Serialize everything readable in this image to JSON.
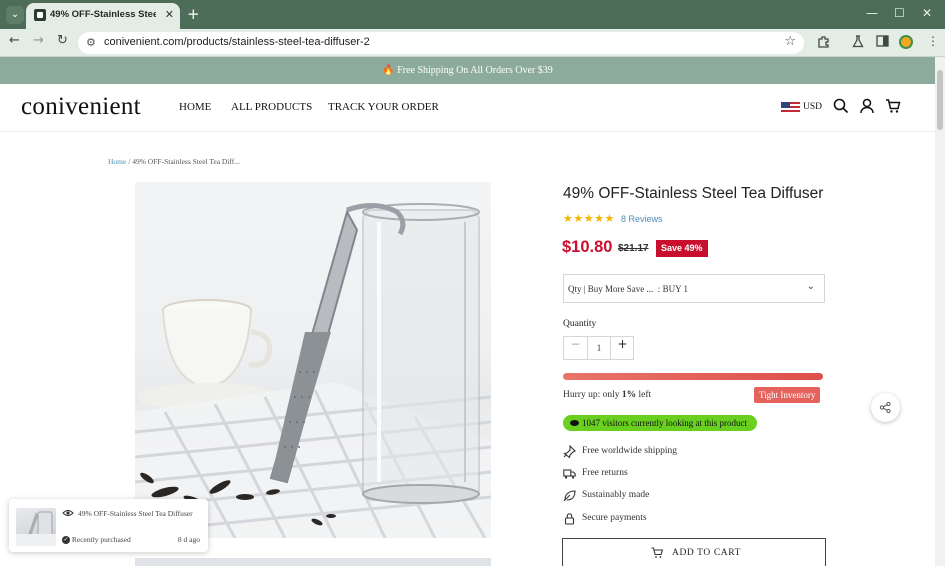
{
  "browser": {
    "tab_title": "49% OFF-Stainless Steel Tea Diffuser",
    "tab_close": "✕",
    "new_tab": "+",
    "url": "conivenient.com/products/stainless-steel-tea-diffuser-2",
    "window_controls": {
      "minimize": "—",
      "maximize": "☐",
      "close": "✕"
    }
  },
  "promo": {
    "text": "🔥 Free Shipping On All Orders Over $39"
  },
  "header": {
    "logo": "conivenient",
    "nav": [
      "HOME",
      "ALL PRODUCTS",
      "TRACK YOUR ORDER"
    ],
    "currency": "USD"
  },
  "breadcrumb": {
    "home": "Home",
    "separator": "/",
    "current": "49% OFF-Stainless Steel Tea Diff..."
  },
  "product": {
    "title": "49% OFF-Stainless Steel Tea Diffuser",
    "rating": 5,
    "stars": "★★★★★",
    "reviews": "8 Reviews",
    "price": "$10.80",
    "compare_price": "$21.17",
    "save_badge": "Save 49%",
    "variant_label": "Qty | Buy More Save ...",
    "variant_value": "BUY 1",
    "quantity_label": "Quantity",
    "quantity": "1",
    "qty_minus": "−",
    "qty_plus": "+",
    "stock_fraction": 1.0,
    "hurry_prefix": "Hurry up: only ",
    "hurry_count": "1%",
    "hurry_suffix": " left",
    "tight_badge": "Tight Inventory",
    "visitors": "1047 visitors currently looking at this product",
    "features": [
      {
        "icon": "pin-icon",
        "text": "Free worldwide shipping"
      },
      {
        "icon": "truck-icon",
        "text": "Free returns"
      },
      {
        "icon": "leaf-icon",
        "text": "Sustainably made"
      },
      {
        "icon": "lock-icon",
        "text": "Secure payments"
      }
    ],
    "add_to_cart": "ADD TO CART"
  },
  "popup": {
    "title": "49% OFF-Stainless Steel Tea Diffuser",
    "status": "Recently purchased",
    "time": "8 d ago"
  },
  "colors": {
    "tab_bar": "#4e6d58",
    "promo_bar": "#8cab9c",
    "price": "#c8102e",
    "link": "#4f8fb8",
    "visitors_badge": "#69d01f",
    "tight_badge": "#e5625d",
    "stars": "#f5b400"
  }
}
